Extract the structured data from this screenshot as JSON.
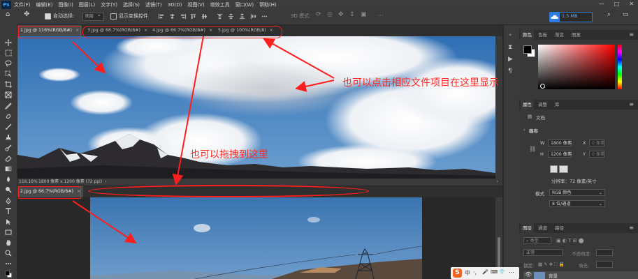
{
  "app": {
    "logo": "Ps"
  },
  "menu": [
    "文件(F)",
    "编辑(E)",
    "图像(I)",
    "图层(L)",
    "文字(Y)",
    "选择(S)",
    "滤镜(T)",
    "3D(D)",
    "视图(V)",
    "增效工具",
    "窗口(W)",
    "帮助(H)"
  ],
  "options": {
    "auto_select_label": "自动选择:",
    "auto_select_value": "图层",
    "show_transform_label": "显示变换控件",
    "mode_3d_label": "3D 模式:",
    "cloud_label": "1.5 MB"
  },
  "doc_tabs_top": [
    {
      "label": "1.jpg @ 116%(RGB/8#)",
      "close": "×"
    },
    {
      "label": "3.jpg @ 66.7%(RGB/8#)",
      "close": "×"
    },
    {
      "label": "4.jpg @ 66.7%(RGB/8#)",
      "close": "×"
    },
    {
      "label": "5.jpg @ 100%(RGB/8)",
      "close": "×"
    }
  ],
  "doc_tabs_bottom": [
    {
      "label": "2.jpg @ 66.7%(RGB/8#)",
      "close": "×"
    }
  ],
  "status": {
    "zoom": "116.16%",
    "info": "1800 像素 x 1200 像素 (72 ppi)"
  },
  "panel_color": {
    "tabs": [
      "颜色",
      "色板",
      "渐变",
      "图案"
    ]
  },
  "panel_props": {
    "tabs": [
      "属性",
      "调整",
      "库"
    ],
    "doc_label": "文档",
    "section_title": "画布",
    "w_label": "W",
    "w_value": "1800 像素",
    "h_label": "H",
    "h_value": "1200 像素",
    "x_label": "X",
    "x_value": "0 像素",
    "y_label": "Y",
    "y_value": "0 像素",
    "resolution": "分辨率：72 像素/英寸",
    "mode_label": "模式",
    "mode_value": "RGB 颜色",
    "depth_value": "8 位/通道"
  },
  "panel_layers": {
    "tabs": [
      "图层",
      "通道",
      "路径"
    ],
    "filter_placeholder": "类型",
    "blend_mode": "正常",
    "opacity_label": "不透明度:",
    "lock_label": "锁定:",
    "fill_label": "填充:",
    "layer_name": "背景"
  },
  "annotations": {
    "top_text": "也可以点击相应文件项目在这里显示",
    "mid_text": "也可以拖拽到这里"
  },
  "ime": {
    "logo": "S",
    "items": [
      "中",
      "·,",
      "🎤",
      "⌨",
      "👕",
      "⋯"
    ]
  },
  "colors": {
    "annotation": "#ff1e1e",
    "sky": "#3f79b8",
    "cloud_accent": "#2f7de1"
  }
}
